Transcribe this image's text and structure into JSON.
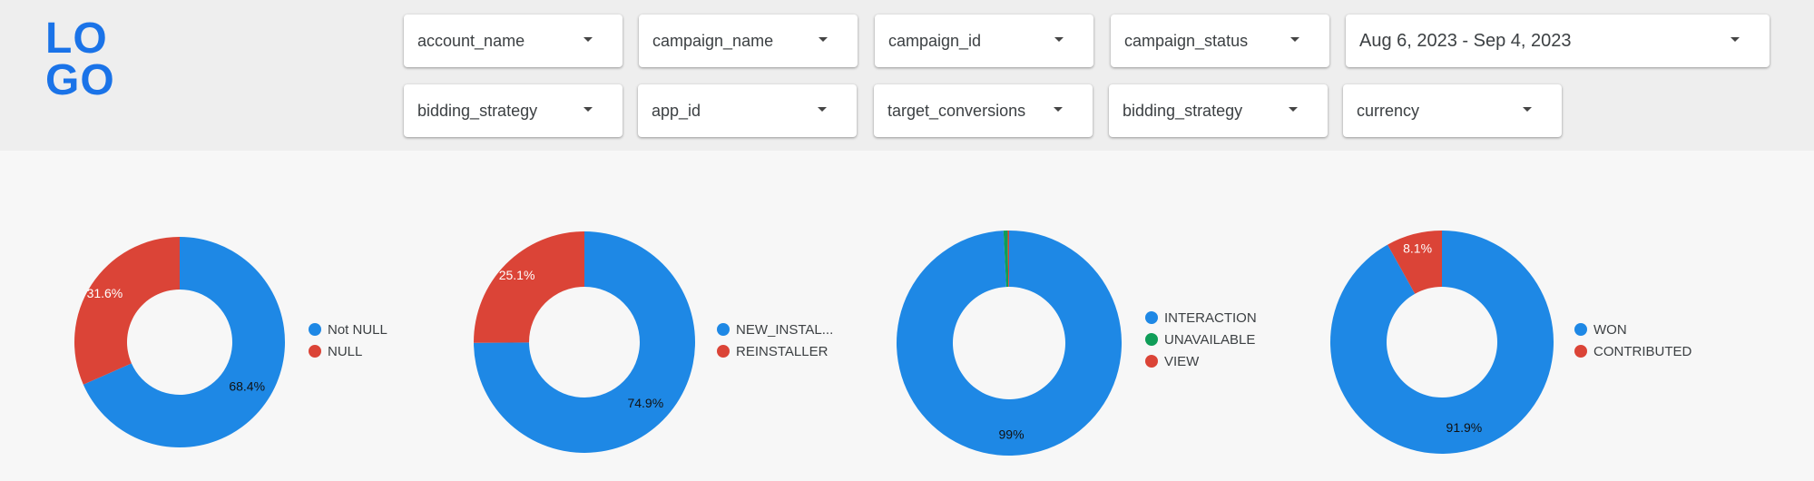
{
  "logo": {
    "line1": "LO",
    "line2": "GO",
    "color": "#1a73e8"
  },
  "filters": {
    "row1": [
      "account_name",
      "campaign_name",
      "campaign_id",
      "campaign_status",
      "Aug 6, 2023 - Sep 4, 2023"
    ],
    "row2": [
      "bidding_strategy",
      "app_id",
      "target_conversions",
      "bidding_strategy",
      "currency"
    ]
  },
  "colors": {
    "blue": "#1e88e5",
    "red": "#db4437",
    "green": "#0f9d58",
    "header_bg": "#eeeeee",
    "page_bg": "#f7f7f7"
  },
  "chart_data": [
    {
      "type": "pie",
      "series": [
        {
          "name": "Not NULL",
          "value": 68.4,
          "label": "68.4%",
          "color": "#1e88e5"
        },
        {
          "name": "NULL",
          "value": 31.6,
          "label": "31.6%",
          "color": "#db4437"
        }
      ]
    },
    {
      "type": "pie",
      "series": [
        {
          "name": "NEW_INSTAL...",
          "value": 74.9,
          "label": "74.9%",
          "color": "#1e88e5"
        },
        {
          "name": "REINSTALLER",
          "value": 25.1,
          "label": "25.1%",
          "color": "#db4437"
        }
      ]
    },
    {
      "type": "pie",
      "series": [
        {
          "name": "INTERACTION",
          "value": 99.2,
          "label": "99%",
          "color": "#1e88e5"
        },
        {
          "name": "UNAVAILABLE",
          "value": 0.6,
          "label": "",
          "color": "#0f9d58"
        },
        {
          "name": "VIEW",
          "value": 0.2,
          "label": "",
          "color": "#db4437"
        }
      ]
    },
    {
      "type": "pie",
      "series": [
        {
          "name": "WON",
          "value": 91.9,
          "label": "91.9%",
          "color": "#1e88e5"
        },
        {
          "name": "CONTRIBUTED",
          "value": 8.1,
          "label": "8.1%",
          "color": "#db4437"
        }
      ]
    }
  ]
}
